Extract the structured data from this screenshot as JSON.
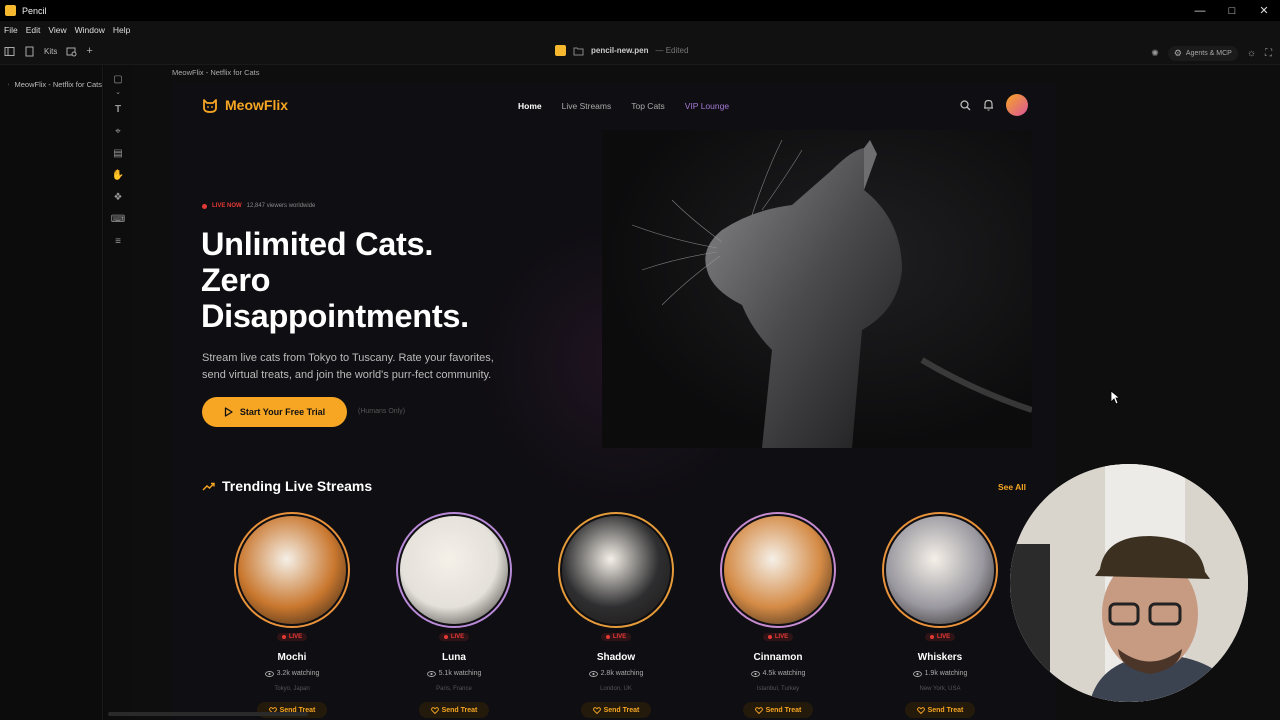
{
  "window": {
    "title": "Pencil"
  },
  "menu": [
    "File",
    "Edit",
    "View",
    "Window",
    "Help"
  ],
  "toolbar": {
    "kits_label": "Kits",
    "file_name": "pencil-new.pen",
    "file_status": "— Edited",
    "agents_label": "Agents & MCP"
  },
  "layers": {
    "item_label": "MeowFlix - Netflix for Cats"
  },
  "canvas": {
    "frame_label": "MeowFlix - Netflix for Cats"
  },
  "site": {
    "logo": "MeowFlix",
    "nav": [
      "Home",
      "Live Streams",
      "Top Cats",
      "VIP Lounge"
    ],
    "hero": {
      "live_label": "LIVE NOW",
      "viewers": "12,847 viewers worldwide",
      "headline_1": "Unlimited Cats.",
      "headline_2": "Zero",
      "headline_3": "Disappointments.",
      "sub_1": "Stream live cats from Tokyo to Tuscany. Rate your favorites,",
      "sub_2": "send virtual treats, and join the world's purr-fect community.",
      "cta": "Start Your Free Trial",
      "cta_note": "(Humans Only)"
    },
    "trending": {
      "title": "Trending Live Streams",
      "see_all": "See All",
      "live_badge": "LIVE",
      "treat_label": "Send Treat",
      "cats": [
        {
          "name": "Mochi",
          "watching": "3.2k watching",
          "location": "Tokyo, Japan",
          "ring": "#e8923b",
          "photo": "#c9772e"
        },
        {
          "name": "Luna",
          "watching": "5.1k watching",
          "location": "Paris, France",
          "ring": "#b98ad8",
          "photo": "#e4e0da"
        },
        {
          "name": "Shadow",
          "watching": "2.8k watching",
          "location": "London, UK",
          "ring": "#e59b3a",
          "photo": "#2e2e30"
        },
        {
          "name": "Cinnamon",
          "watching": "4.5k watching",
          "location": "Istanbul, Turkey",
          "ring": "#c78bd0",
          "photo": "#d48a45"
        },
        {
          "name": "Whiskers",
          "watching": "1.9k watching",
          "location": "New York, USA",
          "ring": "#e8923b",
          "photo": "#9a98a0"
        }
      ]
    }
  },
  "colors": {
    "accent": "#f7a623",
    "live": "#e53935",
    "vip": "#a57ad6"
  }
}
